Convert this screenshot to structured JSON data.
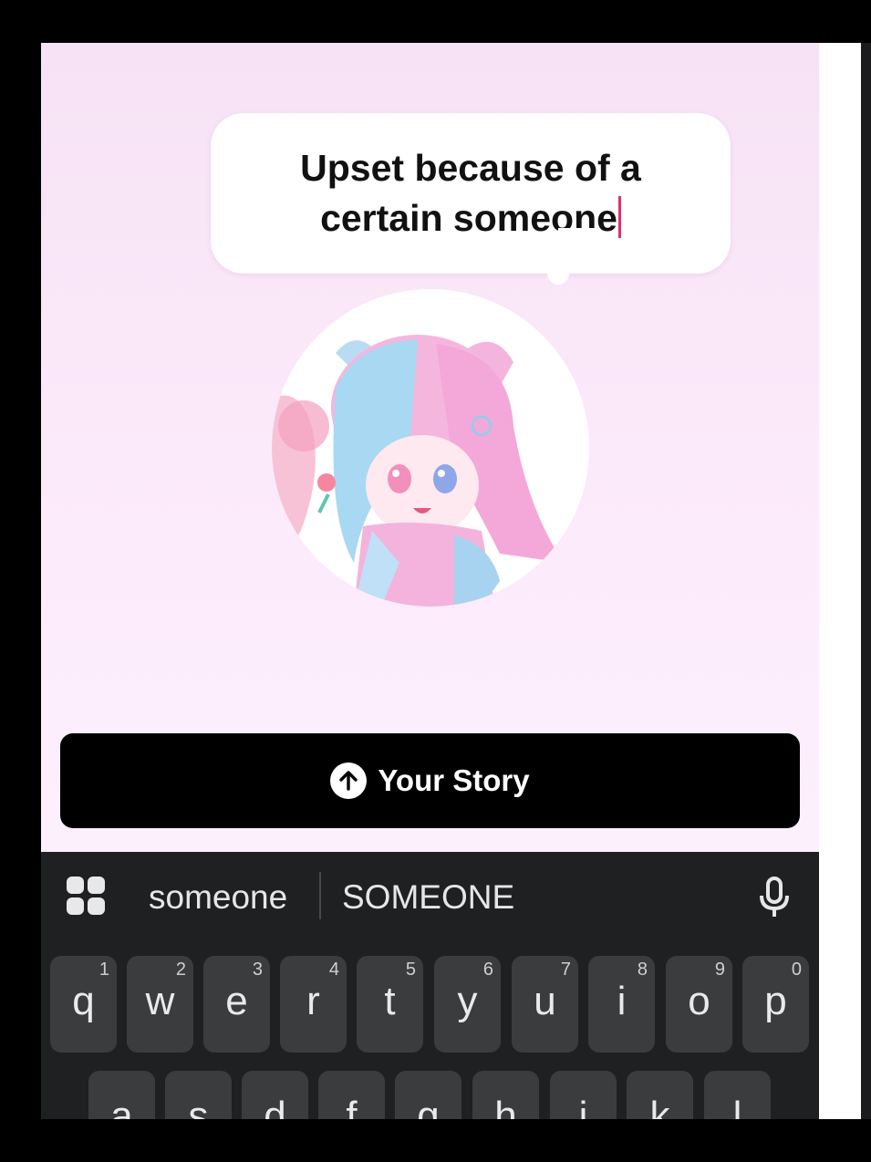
{
  "bubble": {
    "text": "Upset because of a certain someone"
  },
  "story_button": {
    "label": "Your Story"
  },
  "keyboard": {
    "suggestions": [
      "someone",
      "SOMEONE"
    ],
    "row1": [
      {
        "letter": "q",
        "num": "1"
      },
      {
        "letter": "w",
        "num": "2"
      },
      {
        "letter": "e",
        "num": "3"
      },
      {
        "letter": "r",
        "num": "4"
      },
      {
        "letter": "t",
        "num": "5"
      },
      {
        "letter": "y",
        "num": "6"
      },
      {
        "letter": "u",
        "num": "7"
      },
      {
        "letter": "i",
        "num": "8"
      },
      {
        "letter": "o",
        "num": "9"
      },
      {
        "letter": "p",
        "num": "0"
      }
    ],
    "row2": [
      "a",
      "s",
      "d",
      "f",
      "g",
      "h",
      "j",
      "k",
      "l"
    ]
  },
  "colors": {
    "accent_caret": "#e0306a",
    "keyboard_bg": "#1f2021",
    "key_bg": "#3b3c3e"
  },
  "icons": [
    "upload-arrow-icon",
    "apps-grid-icon",
    "microphone-icon"
  ]
}
